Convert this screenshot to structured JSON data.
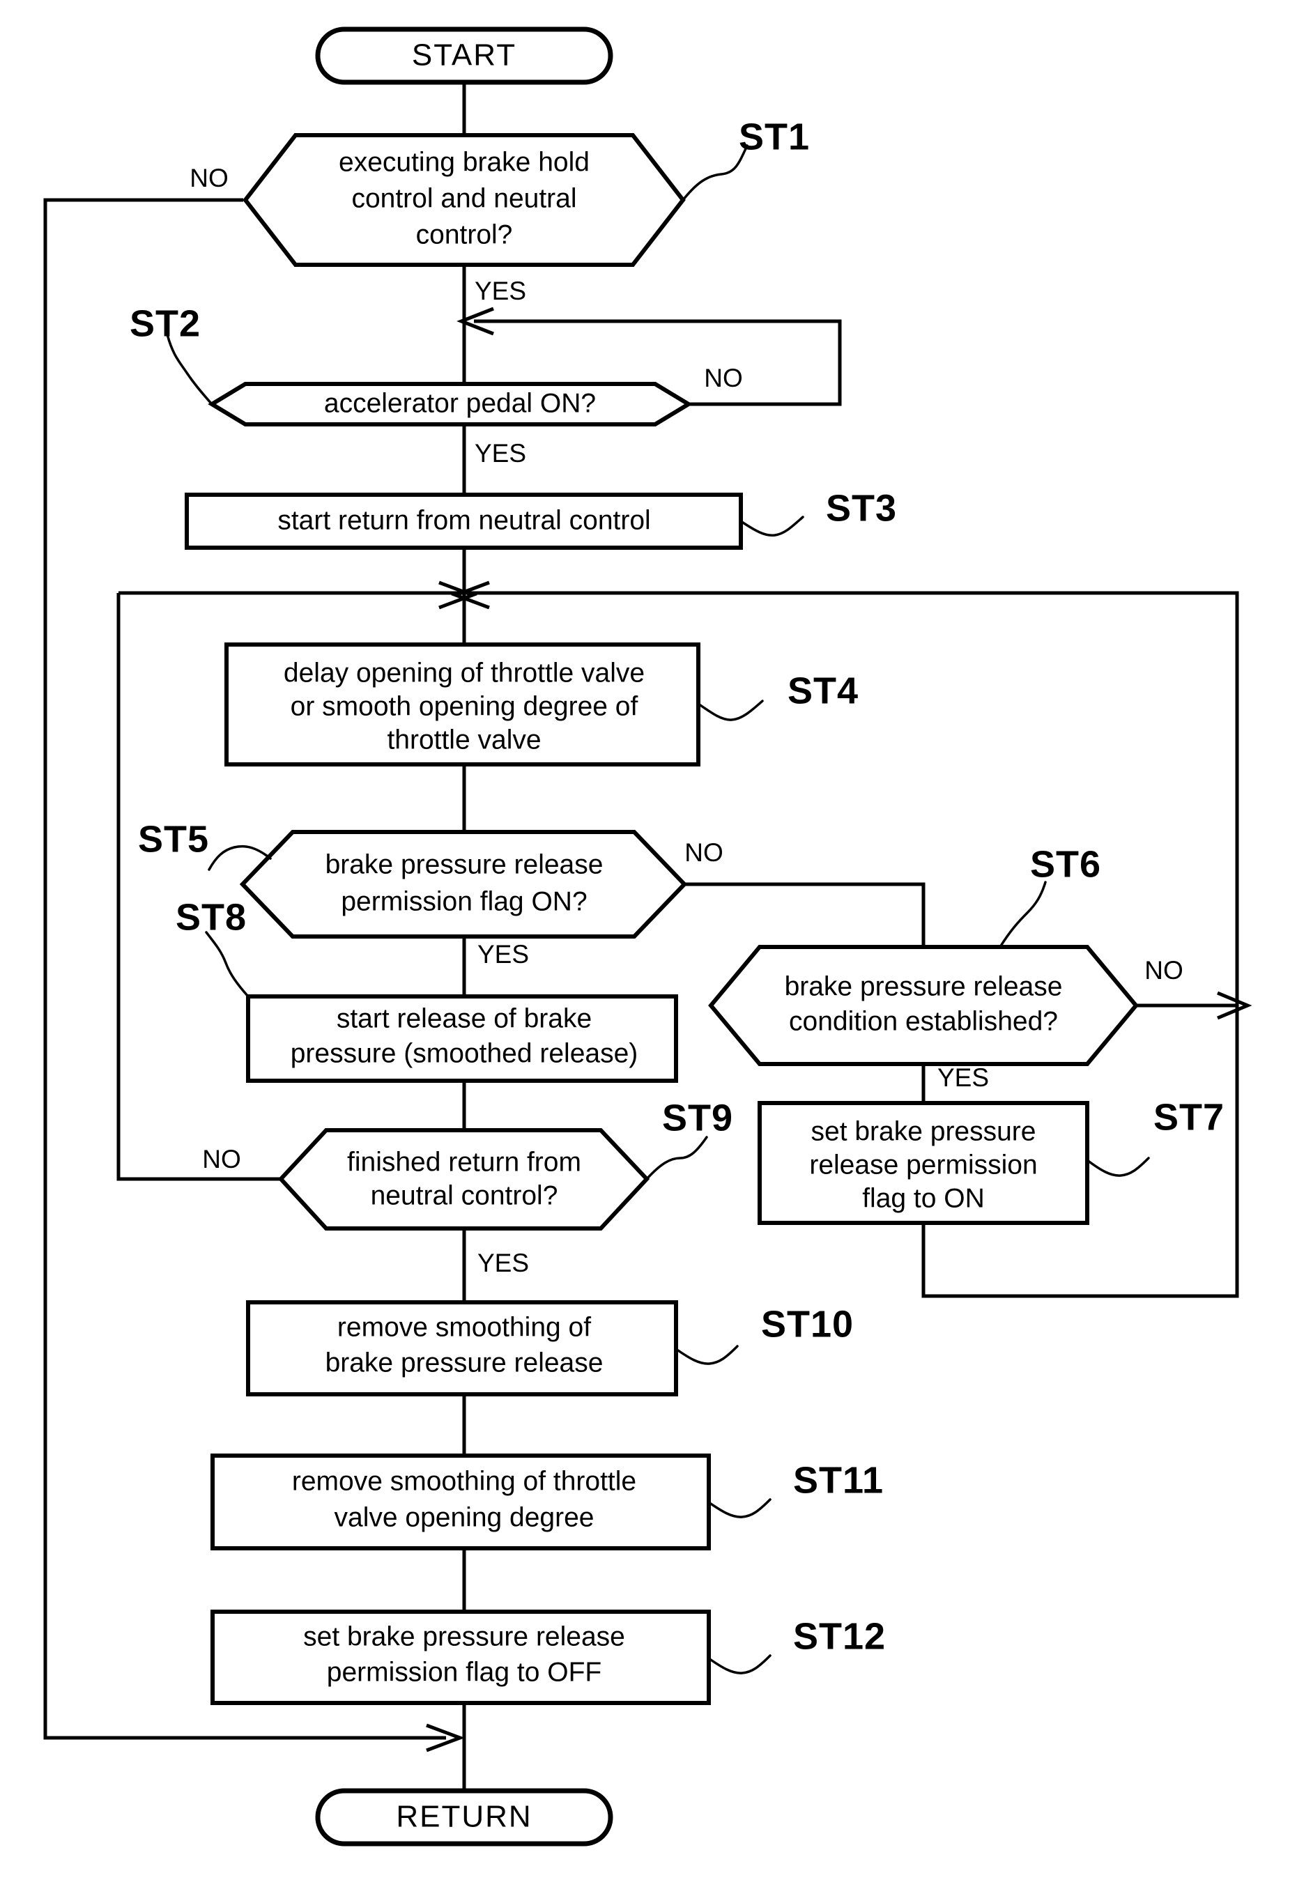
{
  "diagram": {
    "title_terminals": {
      "start": "START",
      "return": "RETURN"
    },
    "branch_labels": {
      "yes": "YES",
      "no": "NO"
    },
    "nodes": [
      {
        "id": "start",
        "tag": "",
        "shape": "terminal",
        "lines": [
          "START"
        ]
      },
      {
        "id": "st1",
        "tag": "ST1",
        "shape": "hexagon",
        "lines": [
          "executing brake hold",
          "control and neutral",
          "control?"
        ]
      },
      {
        "id": "st2",
        "tag": "ST2",
        "shape": "hexagon",
        "lines": [
          "accelerator pedal ON?"
        ]
      },
      {
        "id": "st3",
        "tag": "ST3",
        "shape": "rect",
        "lines": [
          "start return from neutral control"
        ]
      },
      {
        "id": "st4",
        "tag": "ST4",
        "shape": "rect",
        "lines": [
          "delay opening of throttle valve",
          "or smooth opening degree of",
          "throttle valve"
        ]
      },
      {
        "id": "st5",
        "tag": "ST5",
        "shape": "hexagon",
        "lines": [
          "brake pressure release",
          "permission flag ON?"
        ]
      },
      {
        "id": "st6",
        "tag": "ST6",
        "shape": "hexagon",
        "lines": [
          "brake pressure release",
          "condition established?"
        ]
      },
      {
        "id": "st7",
        "tag": "ST7",
        "shape": "rect",
        "lines": [
          "set brake pressure",
          "release permission",
          "flag to ON"
        ]
      },
      {
        "id": "st8",
        "tag": "ST8",
        "shape": "rect",
        "lines": [
          "start release of brake",
          "pressure (smoothed release)"
        ]
      },
      {
        "id": "st9",
        "tag": "ST9",
        "shape": "hexagon",
        "lines": [
          "finished return from",
          "neutral control?"
        ]
      },
      {
        "id": "st10",
        "tag": "ST10",
        "shape": "rect",
        "lines": [
          "remove smoothing of",
          "brake pressure release"
        ]
      },
      {
        "id": "st11",
        "tag": "ST11",
        "shape": "rect",
        "lines": [
          "remove smoothing of throttle",
          "valve opening degree"
        ]
      },
      {
        "id": "st12",
        "tag": "ST12",
        "shape": "rect",
        "lines": [
          "set brake pressure release",
          "permission flag to OFF"
        ]
      },
      {
        "id": "return",
        "tag": "",
        "shape": "terminal",
        "lines": [
          "RETURN"
        ]
      }
    ],
    "edge_labels": [
      {
        "id": "st1-no",
        "text": "NO"
      },
      {
        "id": "st1-yes",
        "text": "YES"
      },
      {
        "id": "st2-no",
        "text": "NO"
      },
      {
        "id": "st2-yes",
        "text": "YES"
      },
      {
        "id": "st5-no",
        "text": "NO"
      },
      {
        "id": "st5-yes",
        "text": "YES"
      },
      {
        "id": "st6-no",
        "text": "NO"
      },
      {
        "id": "st6-yes",
        "text": "YES"
      },
      {
        "id": "st9-no",
        "text": "NO"
      },
      {
        "id": "st9-yes",
        "text": "YES"
      }
    ],
    "colors": {
      "stroke": "#000000",
      "fill": "#ffffff",
      "background": "#ffffff"
    }
  }
}
